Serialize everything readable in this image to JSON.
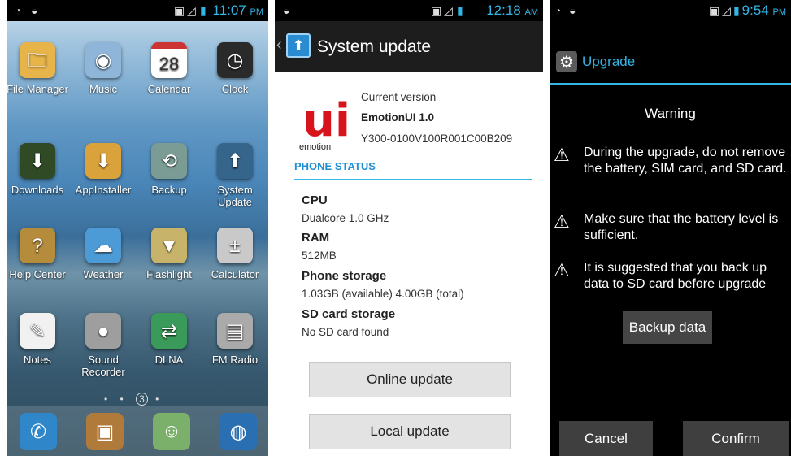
{
  "home": {
    "status_time": "11:07",
    "status_ampm": "PM",
    "calendar_day": "28",
    "page_indicator": "3",
    "apps": [
      {
        "label": "File Manager",
        "icon": "folder-icon",
        "color": "#e7b44a"
      },
      {
        "label": "Music",
        "icon": "cd-icon",
        "color": "#8fb6d8"
      },
      {
        "label": "Calendar",
        "icon": "calendar-icon",
        "color": "#ffffff"
      },
      {
        "label": "Clock",
        "icon": "clock-icon",
        "color": "#2a2a2a"
      },
      {
        "label": "Downloads",
        "icon": "download-icon",
        "color": "#2f4a24"
      },
      {
        "label": "AppInstaller",
        "icon": "app-installer-icon",
        "color": "#d9a23a"
      },
      {
        "label": "Backup",
        "icon": "backup-icon",
        "color": "#7b9c95"
      },
      {
        "label": "System Update",
        "icon": "system-update-icon",
        "color": "#36658c"
      },
      {
        "label": "Help Center",
        "icon": "help-icon",
        "color": "#b58c3c"
      },
      {
        "label": "Weather",
        "icon": "weather-icon",
        "color": "#4d9bd6"
      },
      {
        "label": "Flashlight",
        "icon": "flashlight-icon",
        "color": "#c8b36a"
      },
      {
        "label": "Calculator",
        "icon": "calculator-icon",
        "color": "#c9c9c9"
      },
      {
        "label": "Notes",
        "icon": "notes-icon",
        "color": "#f1f1f1"
      },
      {
        "label": "Sound Recorder",
        "icon": "microphone-icon",
        "color": "#9e9e9e"
      },
      {
        "label": "DLNA",
        "icon": "dlna-icon",
        "color": "#3a9a5a"
      },
      {
        "label": "FM Radio",
        "icon": "radio-icon",
        "color": "#aaaaaa"
      }
    ],
    "dock": [
      {
        "icon": "phone-icon",
        "color": "#2f86c8"
      },
      {
        "icon": "contacts-icon",
        "color": "#b07a3a"
      },
      {
        "icon": "messaging-icon",
        "color": "#7bb06a"
      },
      {
        "icon": "browser-icon",
        "color": "#2a6fb2"
      }
    ]
  },
  "update": {
    "status_time": "12:18",
    "status_ampm": "AM",
    "title": "System update",
    "logo_letter": "ui",
    "logo_text": "emotion",
    "current_version_label": "Current version",
    "version_name": "EmotionUI 1.0",
    "version_build": "Y300-0100V100R001C00B209",
    "section_title": "PHONE STATUS",
    "stats": [
      {
        "label": "CPU",
        "value": "Dualcore 1.0 GHz"
      },
      {
        "label": "RAM",
        "value": "512MB"
      },
      {
        "label": "Phone storage",
        "value": "1.03GB (available)  4.00GB (total)"
      },
      {
        "label": "SD card storage",
        "value": "No SD card found"
      }
    ],
    "online_update_label": "Online update",
    "local_update_label": "Local update",
    "accent": "#33b5e5"
  },
  "upgrade": {
    "status_time": "9:54",
    "status_ampm": "PM",
    "title": "Upgrade",
    "warning_heading": "Warning",
    "warnings": [
      "During the upgrade, do not remove the battery, SIM card, and SD card.",
      "Make sure that the battery level is sufficient.",
      "It is suggested that you back up data to SD card before upgrade"
    ],
    "backup_label": "Backup data",
    "cancel_label": "Cancel",
    "confirm_label": "Confirm"
  }
}
